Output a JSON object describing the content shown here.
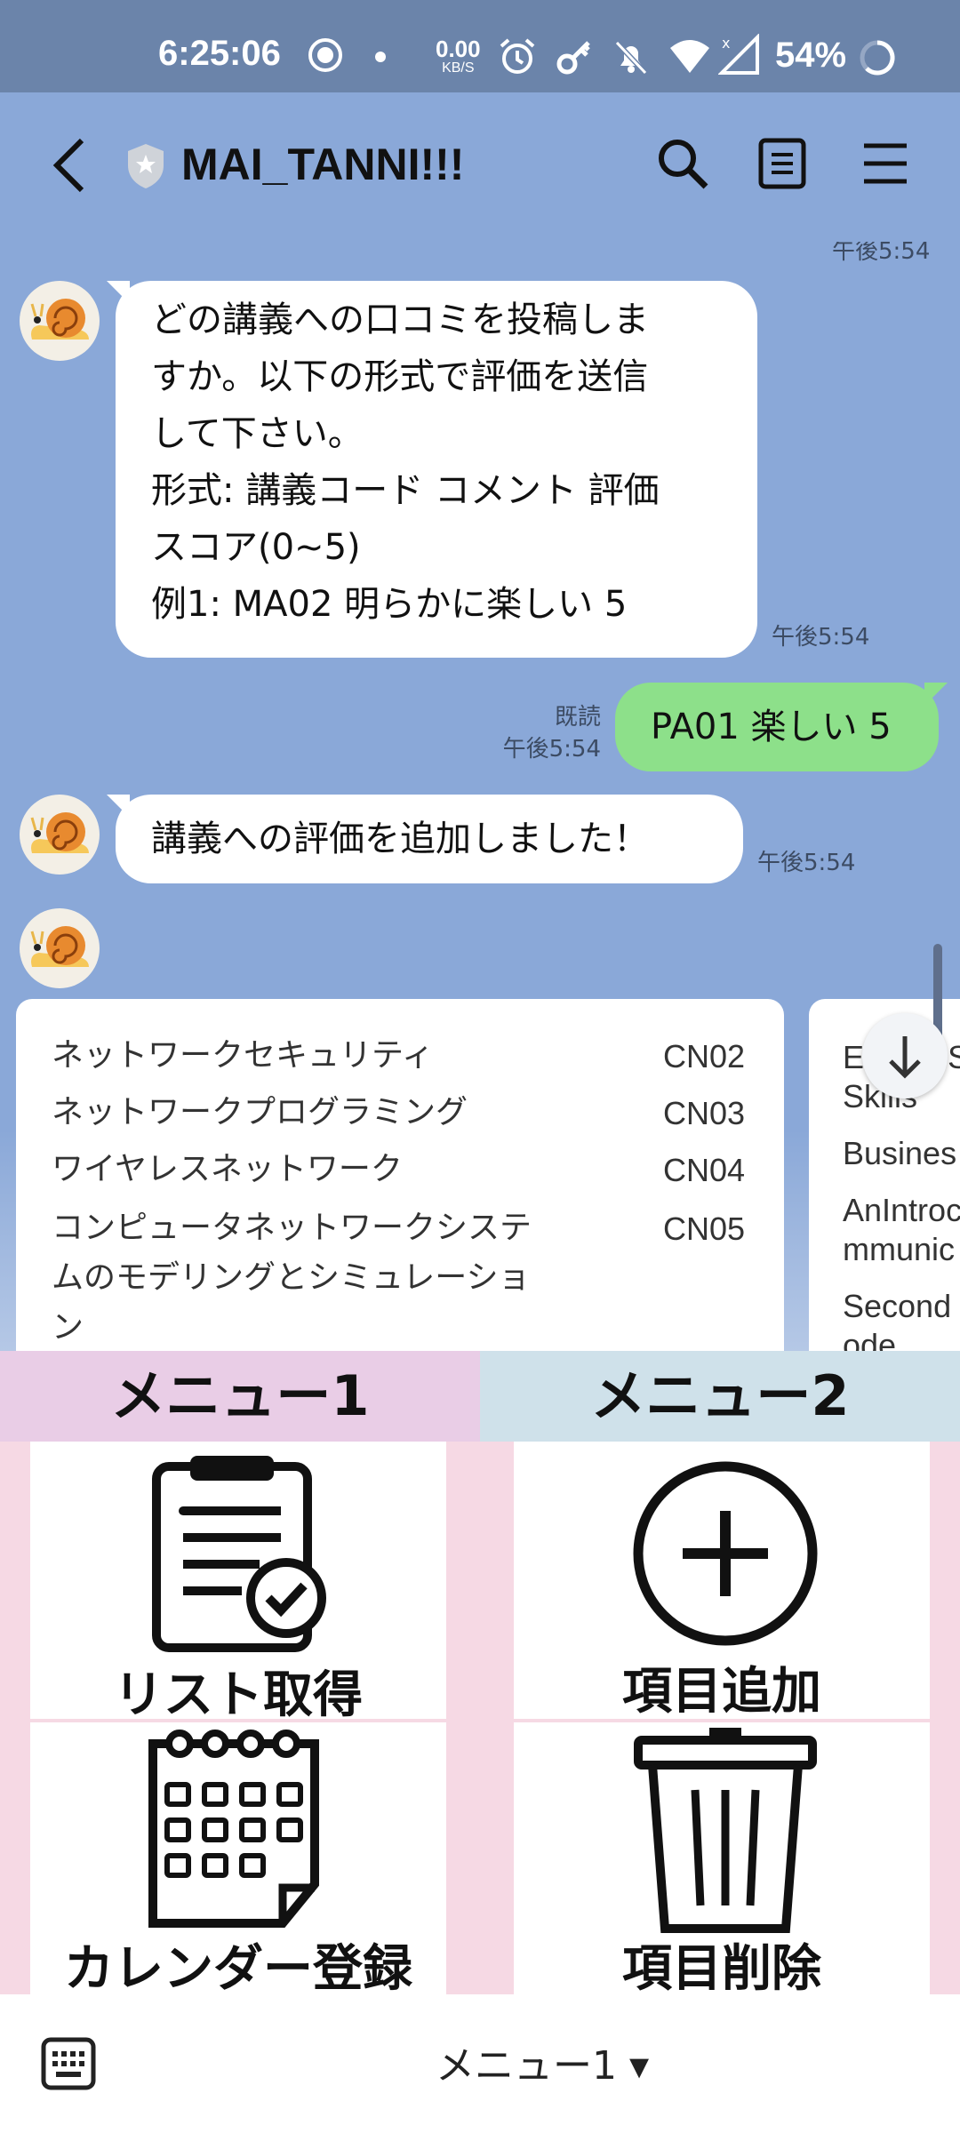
{
  "status_bar": {
    "time": "6:25:06",
    "net_speed_value": "0.00",
    "net_speed_unit": "KB/S",
    "battery": "54%"
  },
  "header": {
    "title": "MAI_TANNI!!!"
  },
  "chat": {
    "top_timestamp": "午後5:54",
    "messages": [
      {
        "sender": "bot",
        "lines": [
          "どの講義への口コミを投稿しま",
          "すか。以下の形式で評価を送信",
          "して下さい。",
          "形式: 講義コード コメント 評価",
          "スコア(0~5)",
          "例1: MA02 明らかに楽しい 5"
        ],
        "time": "午後5:54"
      },
      {
        "sender": "me",
        "text": "PA01 楽しい 5",
        "read": "既読",
        "time": "午後5:54"
      },
      {
        "sender": "bot",
        "text": "講義への評価を追加しました！",
        "time": "午後5:54"
      }
    ],
    "card1": {
      "rows": [
        {
          "name": "ネットワークセキュリティ",
          "code": "CN02"
        },
        {
          "name": "ネットワークプログラミング",
          "code": "CN03"
        },
        {
          "name": "ワイヤレスネットワーク",
          "code": "CN04"
        },
        {
          "name_lines": [
            "コンピュータネットワークシステ",
            "ムのモデリングとシミュレーショ",
            "ン"
          ],
          "code": "CN05"
        }
      ]
    },
    "card2": {
      "rows": [
        "EnglishS",
        "Skills",
        "Busines",
        "AnIntroc",
        "mmunic",
        "Second",
        "ode"
      ]
    }
  },
  "rich_menu": {
    "tab1": "メニュー1",
    "tab2": "メニュー2",
    "items": [
      {
        "label": "リスト取得",
        "icon": "clipboard-check-icon"
      },
      {
        "label": "項目追加",
        "icon": "plus-circle-icon"
      },
      {
        "label": "カレンダー登録",
        "icon": "calendar-icon"
      },
      {
        "label": "項目削除",
        "icon": "trash-icon"
      }
    ]
  },
  "bottom_bar": {
    "menu_label": "メニュー1 ▾"
  },
  "colors": {
    "chat_bg": "#8aa8d8",
    "status_bar_bg": "#6b84aa",
    "my_bubble": "#8de08a",
    "bot_bubble": "#ffffff"
  }
}
